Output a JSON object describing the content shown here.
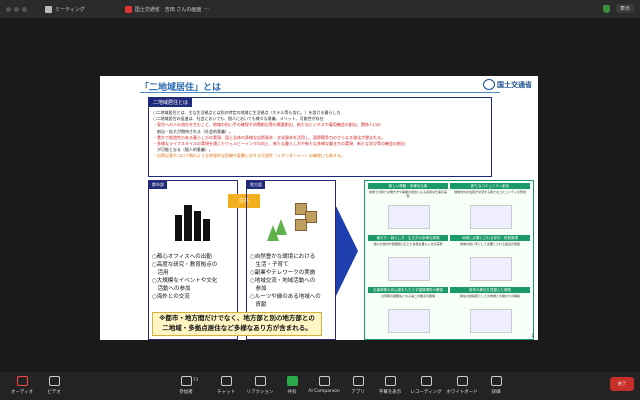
{
  "titlebar": {
    "meeting_label": "ミーティング",
    "share_label": "国土交通省　吉田 さんの画面",
    "view_label": "表示"
  },
  "slide": {
    "title": "「二地域居住」とは",
    "logo": "国土交通省",
    "topbox": {
      "heading": "二地域居住とは",
      "lines": [
        "○二地域居住とは、主な生活拠点とは別の特定の地域に生活拠点（ホテル等も含む。）を設ける暮らし方",
        "○二地域居住の促進は、社会においても、個人においても様々な意義、メリット、可能性が存在",
        "・東京への人の流れを生むこと、地域の担い手の確保や消費創出等の需要創出、新たなビジネスや雇用機会の創出、関係人口の",
        "　創出・拡大が期待される（社会的意義）。",
        "・豊かで創造性のある暮らし方の実現、国土全体の多様な自然資本・文化資本を活用し、国際競争力のさらなる強化が望まれる。",
        "・多様なライフスタイルの実現を通じたウェルビーイングの向上、新たな暮らし方や新たな多様な働き方の実現、新たな学び等の機会の創出",
        "　が可能となる（個人的意義）。",
        "・自然災害やコロナ禍のような突発的な危機や変動に対する冗長性（リダンダンシー）の確保にも資する。"
      ]
    },
    "urban": {
      "heading": "都市部",
      "items": [
        "○都心オフィスへの出勤",
        "○高度な研究・教育拠点の",
        "　活用",
        "○大規模なイベントや文化",
        "　活動への参加",
        "○海外との交流"
      ]
    },
    "rural": {
      "heading": "地方部",
      "items": [
        "○自然豊かな環境における",
        "　生活・子育て",
        "○副業やテレワークの実施",
        "○地域交流・地域活動への",
        "　参加",
        "○ルーツや縁のある地域への",
        "　貢献"
      ]
    },
    "connector": "往来",
    "banner": [
      "※都市・地方間だけでなく、地方部と別の地方部との",
      "二地域・多拠点居住など多様なあり方が含まれる。"
    ],
    "grid": [
      {
        "heading": "新しい移動・多様な仕事",
        "text": "地域での新たな働き方や事業の創出による多様な仕事の実現"
      },
      {
        "heading": "新たなコミュニティ創出",
        "text": "地域内外の住民が交流する新たなコミュニティの形成"
      },
      {
        "heading": "働き方・暮らし方・生き方の多様な実現",
        "text": "個人の志向や価値観に応じた多様な暮らし方の実現"
      },
      {
        "heading": "地域に必要とされる存在・役割実現",
        "text": "地域の担い手として必要とされる役割の発揮"
      },
      {
        "heading": "災害時等の安心感をもたらす避難場所の確保",
        "text": "災害時の避難先となる第二の拠点の確保"
      },
      {
        "heading": "将来の移住を見据えた実践",
        "text": "移住の前段階としての地域との関わりの構築"
      }
    ],
    "page_number": "1"
  },
  "zoombar": {
    "items": [
      {
        "label": "オーディオ",
        "icon": "microphone-muted-icon"
      },
      {
        "label": "ビデオ",
        "icon": "camera-icon"
      },
      {
        "label": "参加者",
        "icon": "participants-icon"
      },
      {
        "label": "チャット",
        "icon": "chat-icon"
      },
      {
        "label": "リアクション",
        "icon": "heart-icon"
      },
      {
        "label": "共有",
        "icon": "share-screen-icon"
      },
      {
        "label": "AI Companion",
        "icon": "sparkle-icon"
      },
      {
        "label": "アプリ",
        "icon": "apps-icon"
      },
      {
        "label": "字幕を表示",
        "icon": "captions-icon"
      },
      {
        "label": "レコーディング",
        "icon": "record-icon"
      },
      {
        "label": "ホワイトボード",
        "icon": "whiteboard-icon"
      },
      {
        "label": "詳細",
        "icon": "more-icon"
      }
    ],
    "participant_count": "73",
    "end_label": "終了"
  }
}
